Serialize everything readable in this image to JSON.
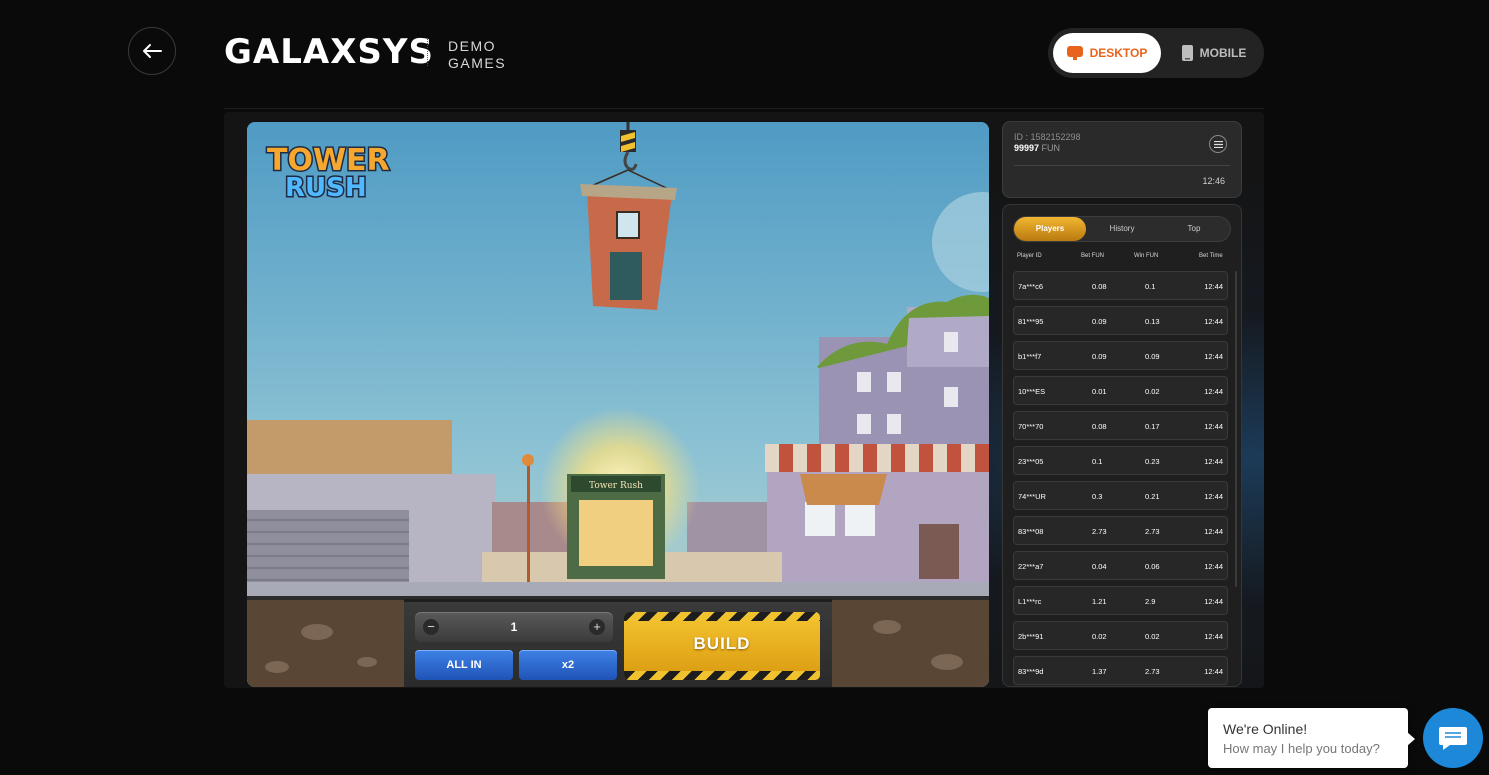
{
  "header": {
    "logo": "GALAXSYS",
    "demo_line1": "DEMO",
    "demo_line2": "GAMES",
    "toggle_desktop": "DESKTOP",
    "toggle_mobile": "MOBILE"
  },
  "game": {
    "title_line1": "TOWER",
    "title_line2": "RUSH",
    "shop_sign": "Tower Rush",
    "bet_value": "1",
    "minus": "−",
    "plus": "+",
    "all_in_label": "ALL IN",
    "x2_label": "x2",
    "build_label": "BUILD"
  },
  "account": {
    "id_text": "ID : 1582152298",
    "balance": "99997",
    "currency": "FUN",
    "time": "12:46"
  },
  "players_panel": {
    "tabs": [
      "Players",
      "History",
      "Top"
    ],
    "active_tab": "Players",
    "columns": {
      "player_id": "Player ID",
      "bet": "Bet  FUN",
      "win": "Win  FUN",
      "bet_time": "Bet Time"
    },
    "rows": [
      {
        "id": "7a***c6",
        "bet": "0.08",
        "win": "0.1",
        "time": "12:44"
      },
      {
        "id": "81***95",
        "bet": "0.09",
        "win": "0.13",
        "time": "12:44"
      },
      {
        "id": "b1***f7",
        "bet": "0.09",
        "win": "0.09",
        "time": "12:44"
      },
      {
        "id": "10***ES",
        "bet": "0.01",
        "win": "0.02",
        "time": "12:44"
      },
      {
        "id": "70***70",
        "bet": "0.08",
        "win": "0.17",
        "time": "12:44"
      },
      {
        "id": "23***05",
        "bet": "0.1",
        "win": "0.23",
        "time": "12:44"
      },
      {
        "id": "74***UR",
        "bet": "0.3",
        "win": "0.21",
        "time": "12:44"
      },
      {
        "id": "83***08",
        "bet": "2.73",
        "win": "2.73",
        "time": "12:44"
      },
      {
        "id": "22***a7",
        "bet": "0.04",
        "win": "0.06",
        "time": "12:44"
      },
      {
        "id": "L1***rc",
        "bet": "1.21",
        "win": "2.9",
        "time": "12:44"
      },
      {
        "id": "2b***91",
        "bet": "0.02",
        "win": "0.02",
        "time": "12:44"
      },
      {
        "id": "83***9d",
        "bet": "1.37",
        "win": "2.73",
        "time": "12:44"
      }
    ]
  },
  "chat": {
    "title": "We're Online!",
    "subtitle": "How may I help you today?"
  },
  "colors": {
    "accent_orange": "#e8641e",
    "tab_gold": "#f2b632",
    "chat_blue": "#1e88d8",
    "button_blue": "#2f6cd6"
  }
}
